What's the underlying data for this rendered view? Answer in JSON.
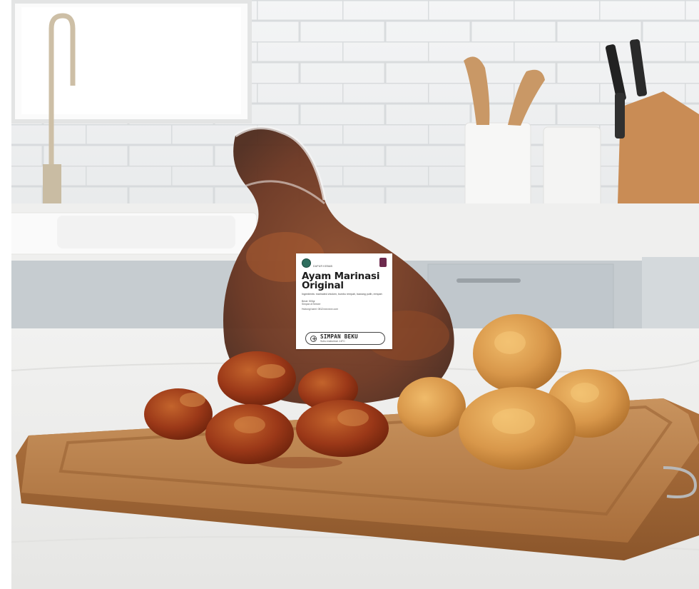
{
  "photo": {
    "description_free": true,
    "colors": {
      "wall": "#eef0f1",
      "grout": "#d4d7d9",
      "counter": "#f3f3f2",
      "cabinet": "#c9cfd3",
      "board": "#b47a45",
      "marinated": "#9c3b18",
      "fried": "#d99a48"
    }
  },
  "label": {
    "brand": "DAPUR KEBAB",
    "title_line1": "Ayam Marinasi",
    "title_line2": "Original",
    "description": "Ingredients: marinated chicken, bumbu rempah, bawang putih, rempah",
    "meta_1": "Berat: 500gr",
    "meta_2": "Simpan di freezer",
    "meta_3": "Hubungi kami: 0812xxxxxxxx.com",
    "store_title": "SIMPAN BEKU",
    "store_sub": "Suhu maksimal -18°C"
  }
}
